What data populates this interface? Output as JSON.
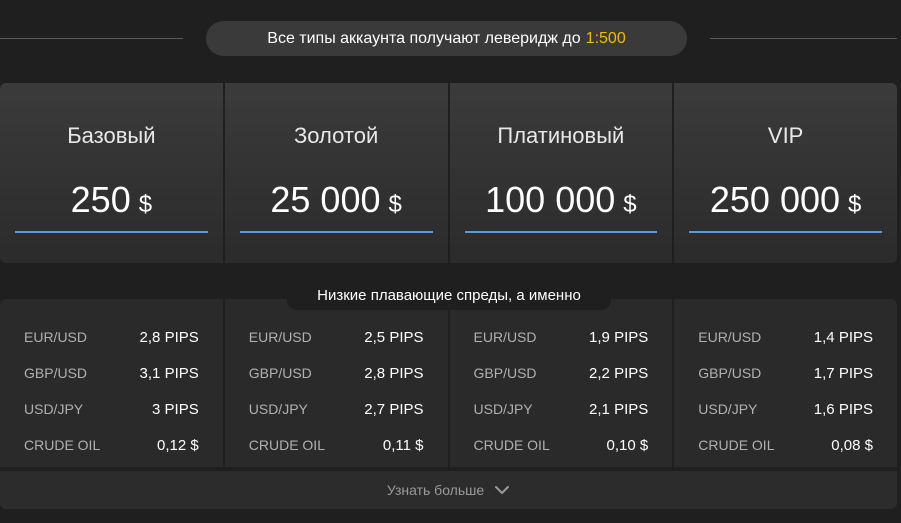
{
  "leverage": {
    "text": "Все типы аккаунта получают леверидж до",
    "value": "1:500",
    "accent_color": "#f5b800"
  },
  "plans": [
    {
      "name": "Базовый",
      "amount": "250",
      "currency": "$"
    },
    {
      "name": "Золотой",
      "amount": "25 000",
      "currency": "$"
    },
    {
      "name": "Платиновый",
      "amount": "100 000",
      "currency": "$"
    },
    {
      "name": "VIP",
      "amount": "250 000",
      "currency": "$"
    }
  ],
  "spreads": {
    "title": "Низкие плавающие спреды, а именно",
    "columns": [
      [
        {
          "pair": "EUR/USD",
          "value": "2,8 PIPS"
        },
        {
          "pair": "GBP/USD",
          "value": "3,1 PIPS"
        },
        {
          "pair": "USD/JPY",
          "value": "3 PIPS"
        },
        {
          "pair": "CRUDE OIL",
          "value": "0,12 $"
        }
      ],
      [
        {
          "pair": "EUR/USD",
          "value": "2,5 PIPS"
        },
        {
          "pair": "GBP/USD",
          "value": "2,8 PIPS"
        },
        {
          "pair": "USD/JPY",
          "value": "2,7 PIPS"
        },
        {
          "pair": "CRUDE OIL",
          "value": "0,11 $"
        }
      ],
      [
        {
          "pair": "EUR/USD",
          "value": "1,9 PIPS"
        },
        {
          "pair": "GBP/USD",
          "value": "2,2 PIPS"
        },
        {
          "pair": "USD/JPY",
          "value": "2,1 PIPS"
        },
        {
          "pair": "CRUDE OIL",
          "value": "0,10 $"
        }
      ],
      [
        {
          "pair": "EUR/USD",
          "value": "1,4 PIPS"
        },
        {
          "pair": "GBP/USD",
          "value": "1,7 PIPS"
        },
        {
          "pair": "USD/JPY",
          "value": "1,6 PIPS"
        },
        {
          "pair": "CRUDE OIL",
          "value": "0,08 $"
        }
      ]
    ]
  },
  "more": {
    "label": "Узнать больше",
    "icon": "chevron-down-icon"
  },
  "colors": {
    "background": "#1f1f1f",
    "panel": "#333333",
    "underline": "#5b9bd5"
  }
}
